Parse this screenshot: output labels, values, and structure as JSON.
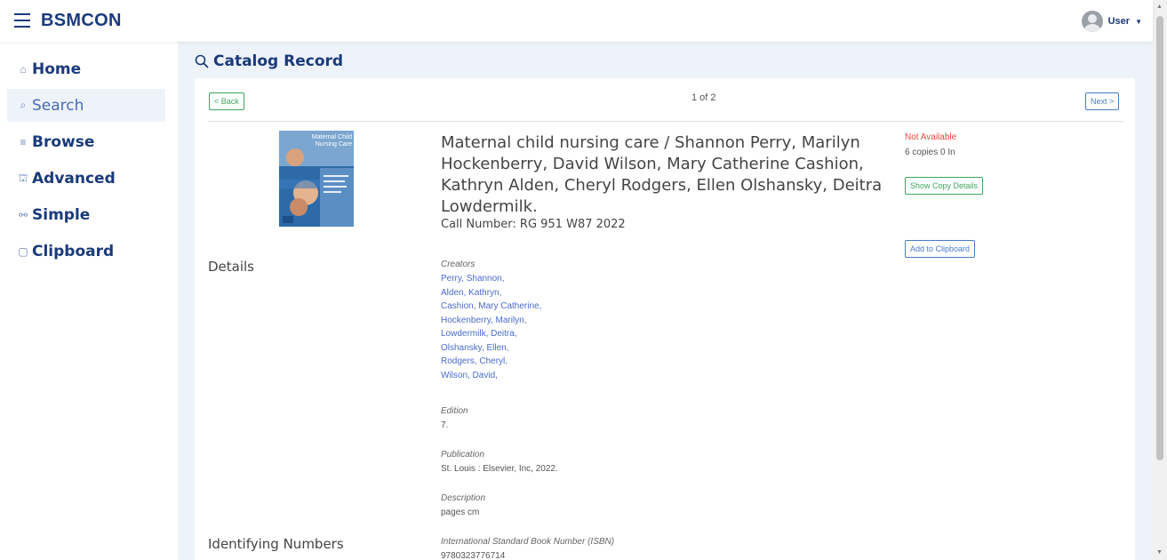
{
  "app": {
    "brand": "BSMCON"
  },
  "user": {
    "label": "User"
  },
  "sidebar": {
    "items": [
      {
        "label": "Home",
        "icon": "⌂"
      },
      {
        "label": "Search",
        "icon": "⌕"
      },
      {
        "label": "Browse",
        "icon": "≡"
      },
      {
        "label": "Advanced",
        "icon": "⛫"
      },
      {
        "label": "Simple",
        "icon": "⚯"
      },
      {
        "label": "Clipboard",
        "icon": "▢"
      }
    ]
  },
  "page": {
    "title": "Catalog Record"
  },
  "nav": {
    "back": "< Back",
    "next": "Next >",
    "pager": "1 of 2"
  },
  "record": {
    "title": "Maternal child nursing care / Shannon Perry, Marilyn Hockenberry, David Wilson, Mary Catherine Cashion, Kathryn Alden, Cheryl Rodgers, Ellen Olshansky, Deitra Lowdermilk.",
    "call_number": "Call Number: RG 951 W87 2022",
    "cover_title": "Maternal Child Nursing Care"
  },
  "availability": {
    "status": "Not Available",
    "copies": "6 copies  0 In",
    "show_copy_details": "Show Copy Details",
    "add_to_clipboard": "Add to Clipboard"
  },
  "details": {
    "section_label": "Details",
    "creators_label": "Creators",
    "creators": [
      "Perry, Shannon,",
      "Alden, Kathryn,",
      "Cashion, Mary Catherine,",
      "Hockenberry, Marilyn,",
      "Lowdermilk, Deitra,",
      "Olshansky, Ellen,",
      "Rodgers, Cheryl,",
      "Wilson, David,"
    ],
    "edition_label": "Edition",
    "edition": "7.",
    "publication_label": "Publication",
    "publication": "St. Louis : Elsevier, Inc, 2022.",
    "description_label": "Description",
    "description": "pages cm"
  },
  "identifying": {
    "section_label": "Identifying Numbers",
    "isbn_label": "International Standard Book Number (ISBN)",
    "isbn": "9780323776714"
  },
  "colors": {
    "brand": "#1a3a7a",
    "link": "#4a6bd0",
    "unavailable": "#e74c3c",
    "success": "#3fa55c"
  }
}
